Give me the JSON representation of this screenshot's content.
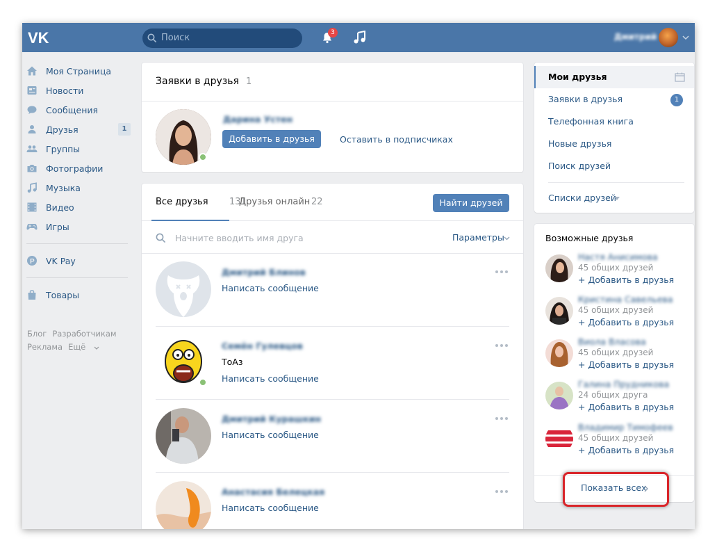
{
  "topbar": {
    "search_placeholder": "Поиск",
    "notifications_count": "3",
    "user_name": "Дмитрий",
    "accent_color": "#4a76a8"
  },
  "left_nav": {
    "items": [
      {
        "label": "Моя Страница",
        "icon": "home-icon"
      },
      {
        "label": "Новости",
        "icon": "news-icon"
      },
      {
        "label": "Сообщения",
        "icon": "messages-icon"
      },
      {
        "label": "Друзья",
        "icon": "friends-icon",
        "count": "1"
      },
      {
        "label": "Группы",
        "icon": "groups-icon"
      },
      {
        "label": "Фотографии",
        "icon": "camera-icon"
      },
      {
        "label": "Музыка",
        "icon": "music-note-icon"
      },
      {
        "label": "Видео",
        "icon": "video-icon"
      },
      {
        "label": "Игры",
        "icon": "gamepad-icon"
      }
    ],
    "pay_label": "VK Pay",
    "goods_label": "Товары",
    "footer": {
      "blog": "Блог",
      "developers": "Разработчикам",
      "ads": "Реклама",
      "more": "Ещё"
    }
  },
  "requests": {
    "title": "Заявки в друзья",
    "count": "1",
    "person_name": "Дарина Устен",
    "add_button": "Добавить в друзья",
    "keep_button": "Оставить в подписчиках"
  },
  "friends": {
    "tab_all": "Все друзья",
    "tab_all_count": "131",
    "tab_online": "Друзья онлайн",
    "tab_online_count": "22",
    "find_button": "Найти друзей",
    "search_placeholder": "Начните вводить имя друга",
    "params_label": "Параметры",
    "list": [
      {
        "name": "Дмитрий Блинов",
        "status": "",
        "action": "Написать сообщение"
      },
      {
        "name": "Семён Гулевцов",
        "status": "ТоАз",
        "action": "Написать сообщение"
      },
      {
        "name": "Дмитрий Курашкин",
        "status": "",
        "action": "Написать сообщение"
      },
      {
        "name": "Анастасия Белецкая",
        "status": "",
        "action": "Написать сообщение"
      }
    ]
  },
  "right_menu": {
    "items": [
      "Мои друзья",
      "Заявки в друзья",
      "Телефонная книга",
      "Новые друзья",
      "Поиск друзей"
    ],
    "requests_badge": "1",
    "lists_label": "Списки друзей"
  },
  "possible": {
    "title": "Возможные друзья",
    "people": [
      {
        "name": "Настя Анисимова",
        "mutual": "45 общих друзей",
        "add": "Добавить в друзья"
      },
      {
        "name": "Кристина Савельева",
        "mutual": "45 общих друзей",
        "add": "Добавить в друзья"
      },
      {
        "name": "Виола Власова",
        "mutual": "45 общих друзей",
        "add": "Добавить в друзья"
      },
      {
        "name": "Галина Прудникова",
        "mutual": "24 общих друга",
        "add": "Добавить в друзья"
      },
      {
        "name": "Владимир Тимофеев",
        "mutual": "45 общих друзей",
        "add": "Добавить в друзья"
      }
    ],
    "show_all": "Показать всех"
  }
}
